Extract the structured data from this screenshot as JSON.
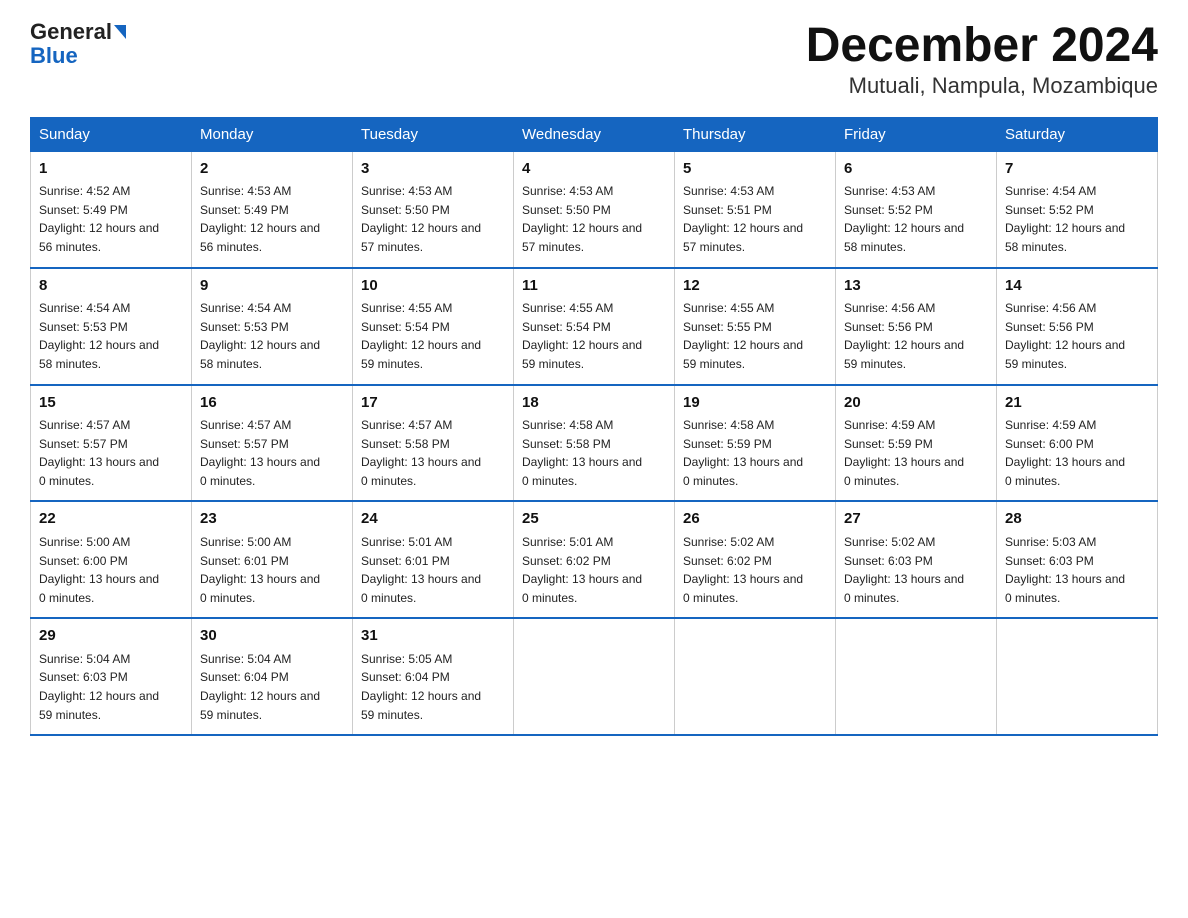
{
  "header": {
    "logo_general": "General",
    "logo_blue": "Blue",
    "title": "December 2024",
    "subtitle": "Mutuali, Nampula, Mozambique"
  },
  "days_of_week": [
    "Sunday",
    "Monday",
    "Tuesday",
    "Wednesday",
    "Thursday",
    "Friday",
    "Saturday"
  ],
  "weeks": [
    [
      {
        "day": "1",
        "sunrise": "4:52 AM",
        "sunset": "5:49 PM",
        "daylight": "12 hours and 56 minutes."
      },
      {
        "day": "2",
        "sunrise": "4:53 AM",
        "sunset": "5:49 PM",
        "daylight": "12 hours and 56 minutes."
      },
      {
        "day": "3",
        "sunrise": "4:53 AM",
        "sunset": "5:50 PM",
        "daylight": "12 hours and 57 minutes."
      },
      {
        "day": "4",
        "sunrise": "4:53 AM",
        "sunset": "5:50 PM",
        "daylight": "12 hours and 57 minutes."
      },
      {
        "day": "5",
        "sunrise": "4:53 AM",
        "sunset": "5:51 PM",
        "daylight": "12 hours and 57 minutes."
      },
      {
        "day": "6",
        "sunrise": "4:53 AM",
        "sunset": "5:52 PM",
        "daylight": "12 hours and 58 minutes."
      },
      {
        "day": "7",
        "sunrise": "4:54 AM",
        "sunset": "5:52 PM",
        "daylight": "12 hours and 58 minutes."
      }
    ],
    [
      {
        "day": "8",
        "sunrise": "4:54 AM",
        "sunset": "5:53 PM",
        "daylight": "12 hours and 58 minutes."
      },
      {
        "day": "9",
        "sunrise": "4:54 AM",
        "sunset": "5:53 PM",
        "daylight": "12 hours and 58 minutes."
      },
      {
        "day": "10",
        "sunrise": "4:55 AM",
        "sunset": "5:54 PM",
        "daylight": "12 hours and 59 minutes."
      },
      {
        "day": "11",
        "sunrise": "4:55 AM",
        "sunset": "5:54 PM",
        "daylight": "12 hours and 59 minutes."
      },
      {
        "day": "12",
        "sunrise": "4:55 AM",
        "sunset": "5:55 PM",
        "daylight": "12 hours and 59 minutes."
      },
      {
        "day": "13",
        "sunrise": "4:56 AM",
        "sunset": "5:56 PM",
        "daylight": "12 hours and 59 minutes."
      },
      {
        "day": "14",
        "sunrise": "4:56 AM",
        "sunset": "5:56 PM",
        "daylight": "12 hours and 59 minutes."
      }
    ],
    [
      {
        "day": "15",
        "sunrise": "4:57 AM",
        "sunset": "5:57 PM",
        "daylight": "13 hours and 0 minutes."
      },
      {
        "day": "16",
        "sunrise": "4:57 AM",
        "sunset": "5:57 PM",
        "daylight": "13 hours and 0 minutes."
      },
      {
        "day": "17",
        "sunrise": "4:57 AM",
        "sunset": "5:58 PM",
        "daylight": "13 hours and 0 minutes."
      },
      {
        "day": "18",
        "sunrise": "4:58 AM",
        "sunset": "5:58 PM",
        "daylight": "13 hours and 0 minutes."
      },
      {
        "day": "19",
        "sunrise": "4:58 AM",
        "sunset": "5:59 PM",
        "daylight": "13 hours and 0 minutes."
      },
      {
        "day": "20",
        "sunrise": "4:59 AM",
        "sunset": "5:59 PM",
        "daylight": "13 hours and 0 minutes."
      },
      {
        "day": "21",
        "sunrise": "4:59 AM",
        "sunset": "6:00 PM",
        "daylight": "13 hours and 0 minutes."
      }
    ],
    [
      {
        "day": "22",
        "sunrise": "5:00 AM",
        "sunset": "6:00 PM",
        "daylight": "13 hours and 0 minutes."
      },
      {
        "day": "23",
        "sunrise": "5:00 AM",
        "sunset": "6:01 PM",
        "daylight": "13 hours and 0 minutes."
      },
      {
        "day": "24",
        "sunrise": "5:01 AM",
        "sunset": "6:01 PM",
        "daylight": "13 hours and 0 minutes."
      },
      {
        "day": "25",
        "sunrise": "5:01 AM",
        "sunset": "6:02 PM",
        "daylight": "13 hours and 0 minutes."
      },
      {
        "day": "26",
        "sunrise": "5:02 AM",
        "sunset": "6:02 PM",
        "daylight": "13 hours and 0 minutes."
      },
      {
        "day": "27",
        "sunrise": "5:02 AM",
        "sunset": "6:03 PM",
        "daylight": "13 hours and 0 minutes."
      },
      {
        "day": "28",
        "sunrise": "5:03 AM",
        "sunset": "6:03 PM",
        "daylight": "13 hours and 0 minutes."
      }
    ],
    [
      {
        "day": "29",
        "sunrise": "5:04 AM",
        "sunset": "6:03 PM",
        "daylight": "12 hours and 59 minutes."
      },
      {
        "day": "30",
        "sunrise": "5:04 AM",
        "sunset": "6:04 PM",
        "daylight": "12 hours and 59 minutes."
      },
      {
        "day": "31",
        "sunrise": "5:05 AM",
        "sunset": "6:04 PM",
        "daylight": "12 hours and 59 minutes."
      },
      {
        "day": "",
        "sunrise": "",
        "sunset": "",
        "daylight": ""
      },
      {
        "day": "",
        "sunrise": "",
        "sunset": "",
        "daylight": ""
      },
      {
        "day": "",
        "sunrise": "",
        "sunset": "",
        "daylight": ""
      },
      {
        "day": "",
        "sunrise": "",
        "sunset": "",
        "daylight": ""
      }
    ]
  ],
  "labels": {
    "sunrise": "Sunrise:",
    "sunset": "Sunset:",
    "daylight": "Daylight:"
  }
}
